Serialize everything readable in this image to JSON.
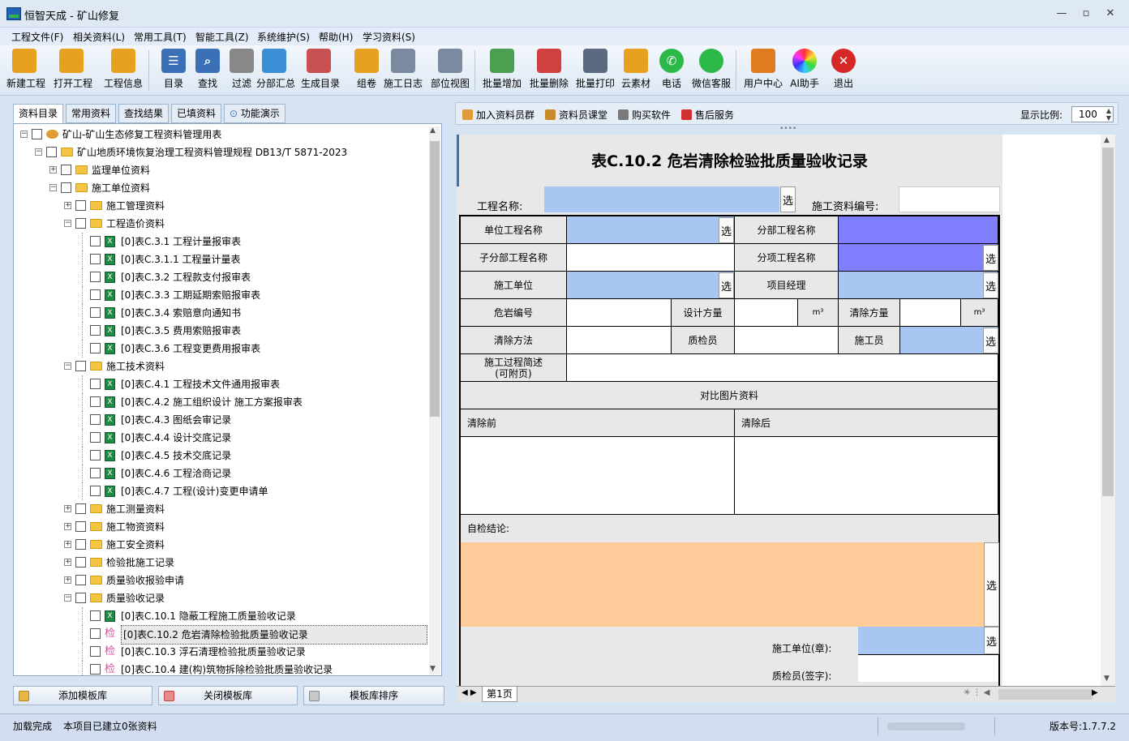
{
  "window": {
    "title": "恒智天成 - 矿山修复"
  },
  "menu": [
    "工程文件(F)",
    "相关资料(L)",
    "常用工具(T)",
    "智能工具(Z)",
    "系统维护(S)",
    "帮助(H)",
    "学习资料(S)"
  ],
  "toolbar": [
    {
      "label": "新建工程",
      "icon": "new-project-icon",
      "color": "#e8a020"
    },
    {
      "label": "打开工程",
      "icon": "open-project-icon",
      "color": "#e8a020"
    },
    {
      "label": "工程信息",
      "icon": "project-info-icon",
      "color": "#e8a020"
    },
    {
      "label": "目录",
      "icon": "list-icon",
      "color": "#3b6fb6"
    },
    {
      "label": "查找",
      "icon": "search-icon",
      "color": "#3b6fb6"
    },
    {
      "label": "过滤",
      "icon": "filter-icon",
      "color": "#888888"
    },
    {
      "label": "分部汇总",
      "icon": "summary-icon",
      "color": "#3b8fd6"
    },
    {
      "label": "生成目录",
      "icon": "generate-catalog-icon",
      "color": "#c85050"
    },
    {
      "label": "组卷",
      "icon": "volume-icon",
      "color": "#e8a020"
    },
    {
      "label": "施工日志",
      "icon": "log-icon",
      "color": "#7a8aa0"
    },
    {
      "label": "部位视图",
      "icon": "part-view-icon",
      "color": "#7a8aa0"
    },
    {
      "label": "批量增加",
      "icon": "batch-add-icon",
      "color": "#4aa050"
    },
    {
      "label": "批量删除",
      "icon": "batch-delete-icon",
      "color": "#d04040"
    },
    {
      "label": "批量打印",
      "icon": "print-icon",
      "color": "#5a6a80"
    },
    {
      "label": "云素材",
      "icon": "cloud-material-icon",
      "color": "#e8a020"
    },
    {
      "label": "电话",
      "icon": "phone-icon",
      "color": "#2db84a"
    },
    {
      "label": "微信客服",
      "icon": "wechat-icon",
      "color": "#2db84a"
    },
    {
      "label": "用户中心",
      "icon": "user-icon",
      "color": "#e07b20"
    },
    {
      "label": "AI助手",
      "icon": "ai-assistant-icon",
      "color": "#c04ad0"
    },
    {
      "label": "退出",
      "icon": "exit-icon",
      "color": "#d62828"
    }
  ],
  "left_tabs": [
    "资料目录",
    "常用资料",
    "查找结果",
    "已填资料",
    "功能演示"
  ],
  "tree": [
    {
      "level": 0,
      "pm": "−",
      "type": "root",
      "label": "矿山-矿山生态修复工程资料管理用表"
    },
    {
      "level": 1,
      "pm": "−",
      "type": "folder",
      "label": "矿山地质环境恢复治理工程资料管理规程 DB13/T 5871-2023"
    },
    {
      "level": 2,
      "pm": "+",
      "type": "folder",
      "label": "监理单位资料"
    },
    {
      "level": 2,
      "pm": "−",
      "type": "folder",
      "label": "施工单位资料"
    },
    {
      "level": 3,
      "pm": "+",
      "type": "folder",
      "label": "施工管理资料"
    },
    {
      "level": 3,
      "pm": "−",
      "type": "folder",
      "label": "工程造价资料"
    },
    {
      "level": 4,
      "pm": "",
      "type": "xls",
      "label": "[0]表C.3.1 工程计量报审表"
    },
    {
      "level": 4,
      "pm": "",
      "type": "xls",
      "label": "[0]表C.3.1.1 工程量计量表"
    },
    {
      "level": 4,
      "pm": "",
      "type": "xls",
      "label": "[0]表C.3.2 工程款支付报审表"
    },
    {
      "level": 4,
      "pm": "",
      "type": "xls",
      "label": "[0]表C.3.3 工期延期索赔报审表"
    },
    {
      "level": 4,
      "pm": "",
      "type": "xls",
      "label": "[0]表C.3.4 索赔意向通知书"
    },
    {
      "level": 4,
      "pm": "",
      "type": "xls",
      "label": "[0]表C.3.5 费用索赔报审表"
    },
    {
      "level": 4,
      "pm": "",
      "type": "xls",
      "label": "[0]表C.3.6 工程变更费用报审表"
    },
    {
      "level": 3,
      "pm": "−",
      "type": "folder",
      "label": "施工技术资料"
    },
    {
      "level": 4,
      "pm": "",
      "type": "xls",
      "label": "[0]表C.4.1 工程技术文件通用报审表"
    },
    {
      "level": 4,
      "pm": "",
      "type": "xls",
      "label": "[0]表C.4.2 施工组织设计 施工方案报审表"
    },
    {
      "level": 4,
      "pm": "",
      "type": "xls",
      "label": "[0]表C.4.3 图纸会审记录"
    },
    {
      "level": 4,
      "pm": "",
      "type": "xls",
      "label": "[0]表C.4.4 设计交底记录"
    },
    {
      "level": 4,
      "pm": "",
      "type": "xls",
      "label": "[0]表C.4.5 技术交底记录"
    },
    {
      "level": 4,
      "pm": "",
      "type": "xls",
      "label": "[0]表C.4.6 工程洽商记录"
    },
    {
      "level": 4,
      "pm": "",
      "type": "xls",
      "label": "[0]表C.4.7 工程(设计)变更申请单"
    },
    {
      "level": 3,
      "pm": "+",
      "type": "folder",
      "label": "施工测量资料"
    },
    {
      "level": 3,
      "pm": "+",
      "type": "folder",
      "label": "施工物资资料"
    },
    {
      "level": 3,
      "pm": "+",
      "type": "folder",
      "label": "施工安全资料"
    },
    {
      "level": 3,
      "pm": "+",
      "type": "folder",
      "label": "检验批施工记录"
    },
    {
      "level": 3,
      "pm": "+",
      "type": "folder",
      "label": "质量验收报验申请"
    },
    {
      "level": 3,
      "pm": "−",
      "type": "folder",
      "label": "质量验收记录"
    },
    {
      "level": 4,
      "pm": "",
      "type": "xls",
      "label": "[0]表C.10.1 隐蔽工程施工质量验收记录"
    },
    {
      "level": 4,
      "pm": "",
      "type": "jian",
      "label": "[0]表C.10.2 危岩清除检验批质量验收记录",
      "selected": true
    },
    {
      "level": 4,
      "pm": "",
      "type": "jian",
      "label": "[0]表C.10.3 浮石清理检验批质量验收记录"
    },
    {
      "level": 4,
      "pm": "",
      "type": "jian",
      "label": "[0]表C.10.4 建(构)筑物拆除检验批质量验收记录"
    }
  ],
  "jian_glyph": "检",
  "left_buttons": [
    "添加模板库",
    "关闭模板库",
    "模板库排序"
  ],
  "right_header": {
    "links": [
      "加入资料员群",
      "资料员课堂",
      "购买软件",
      "售后服务"
    ],
    "zoom_label": "显示比例:",
    "zoom_value": "100"
  },
  "form": {
    "title": "表C.10.2 危岩清除检验批质量验收记录",
    "project_name_label": "工程名称:",
    "doc_no_label": "施工资料编号:",
    "select": "选",
    "unit_project": "单位工程名称",
    "sub_project": "分部工程名称",
    "sub_sub_project": "子分部工程名称",
    "item_project": "分项工程名称",
    "construction_unit": "施工单位",
    "project_manager": "项目经理",
    "rock_no": "危岩编号",
    "design_qty": "设计方量",
    "unit_m3": "m³",
    "clear_qty": "清除方量",
    "clear_method": "清除方法",
    "inspector": "质检员",
    "worker": "施工员",
    "process_desc": "施工过程简述\n(可附页)",
    "photos": "对比图片资料",
    "before": "清除前",
    "after": "清除后",
    "self_check": "自检结论:",
    "unit_seal": "施工单位(章):",
    "inspector_sign": "质检员(签字):"
  },
  "sheet_tab": "第1页",
  "status": {
    "left": "加载完成",
    "info": "本项目已建立0张资料",
    "version": "版本号:1.7.7.2"
  }
}
